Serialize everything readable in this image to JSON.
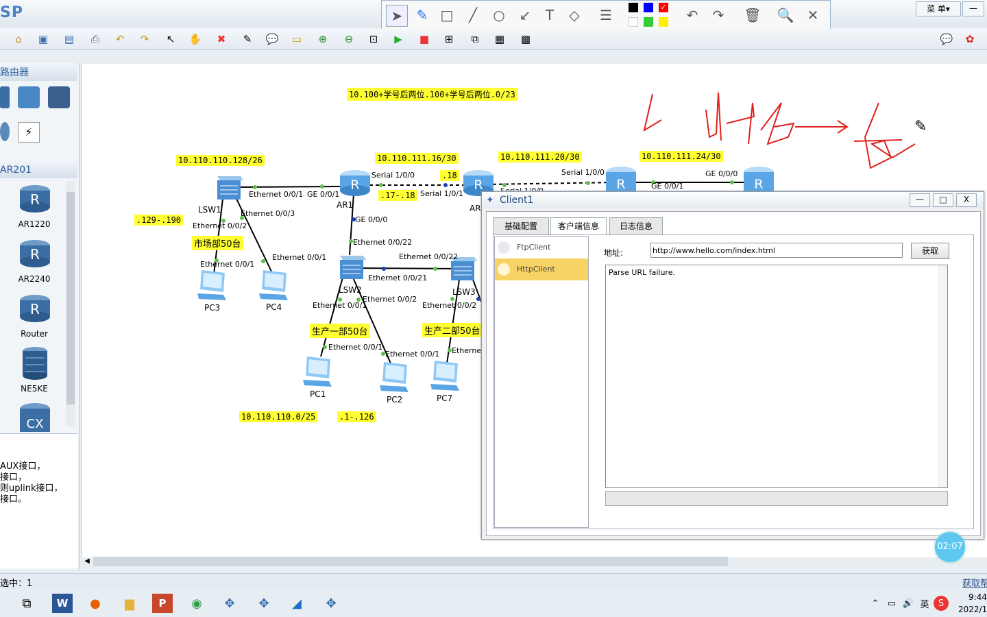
{
  "app": {
    "title": "SP",
    "menu_label": "菜 单",
    "minimize": "—"
  },
  "left_panel": {
    "section1_title": "路由器",
    "section2_title": "AR201",
    "devices": [
      "AR1220",
      "AR2240",
      "Router",
      "NE5KE"
    ],
    "description": [
      "AUX接口，",
      "接口，",
      "则uplink接口，",
      "接口。"
    ]
  },
  "notes": {
    "network": "10.100+学号后两位.100+学号后两位.0/23",
    "lsw1_net": "10.110.110.128/26",
    "link1": "10.110.111.16/30",
    "link1_ip": ".18",
    "link1_range": ".17-.18",
    "link2": "10.110.111.20/30",
    "link3": "10.110.111.24/30",
    "lsw1_range": ".129-.190",
    "market": "市场部50台",
    "prod1": "生产一部50台",
    "prod2": "生产二部50台",
    "prod_net": "10.110.110.0/25",
    "prod_range": ".1-.126"
  },
  "devices": {
    "lsw1": "LSW1",
    "lsw2": "LSW2",
    "lsw3": "LSW3",
    "ar1": "AR1",
    "ar2": "AR",
    "pc1": "PC1",
    "pc2": "PC2",
    "pc3": "PC3",
    "pc4": "PC4",
    "pc7": "PC7"
  },
  "ports": {
    "p1": "Ethernet 0/0/1",
    "p2": "GE 0/0/1",
    "p3": "Serial 1/0/0",
    "p4": "Serial 1/0/1",
    "p5": "Ethernet 0/0/3",
    "p6": "Ethernet 0/0/2",
    "p7": "Ethernet 0/0/1",
    "p8": "Ethernet 0/0/1",
    "p9": "GE 0/0/0",
    "p10": "Ethernet 0/0/22",
    "p11": "Ethernet 0/0/22",
    "p12": "Ethernet 0/0/21",
    "p13": "Ethernet 0/0/1",
    "p14": "Ethernet 0/0/2",
    "p15": "Ethernet 0/0/2",
    "p16": "Ethernet 0/0/1",
    "p17": "Ethernet 0/0/1",
    "p18": "Ethernet",
    "p19": "Serial 1/0/0",
    "p20": "GE 0/0/1",
    "p21": "GE 0/0/0",
    "p22": "Serial 1/0/0"
  },
  "dialog": {
    "title": "Client1",
    "tabs": [
      "基础配置",
      "客户端信息",
      "日志信息"
    ],
    "clients": [
      "FtpClient",
      "HttpClient"
    ],
    "address_label": "地址:",
    "address_value": "http://www.hello.com/index.html",
    "fetch_button": "获取",
    "output": "Parse URL failure.",
    "minimize": "—",
    "maximize": "□",
    "close": "X"
  },
  "timer": "02:07",
  "status": {
    "selected": "选中：1",
    "right": "获取帮"
  },
  "tray": {
    "ime": "英",
    "time": "9:44",
    "date": "2022/1"
  },
  "colors": {
    "note_bg": "#ffff33",
    "accent": "#2a5c9a",
    "selected_row": "#f7d265",
    "timer": "#5ec8f0"
  }
}
